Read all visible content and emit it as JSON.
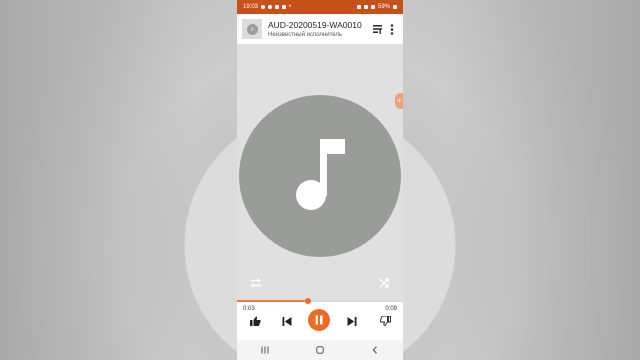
{
  "status_bar": {
    "time": "19:03",
    "battery": "59%"
  },
  "header": {
    "title": "AUD-20200519-WA0010",
    "artist": "Неизвестный исполнитель",
    "thumb_icon": "music-note-icon"
  },
  "player": {
    "progress": 0.43,
    "time_current": "0:03",
    "time_total": "0:09",
    "state": "playing"
  },
  "colors": {
    "accent": "#f06a25",
    "status_bar": "#c8511b",
    "artwork": "#9a9c9a"
  },
  "icons": {
    "like": "thumbs-up-icon",
    "dislike": "thumbs-down-icon",
    "previous": "skip-previous-icon",
    "next": "skip-next-icon",
    "pause": "pause-icon",
    "repeat": "repeat-icon",
    "shuffle": "shuffle-icon",
    "queue": "queue-icon",
    "more": "more-vert-icon"
  }
}
